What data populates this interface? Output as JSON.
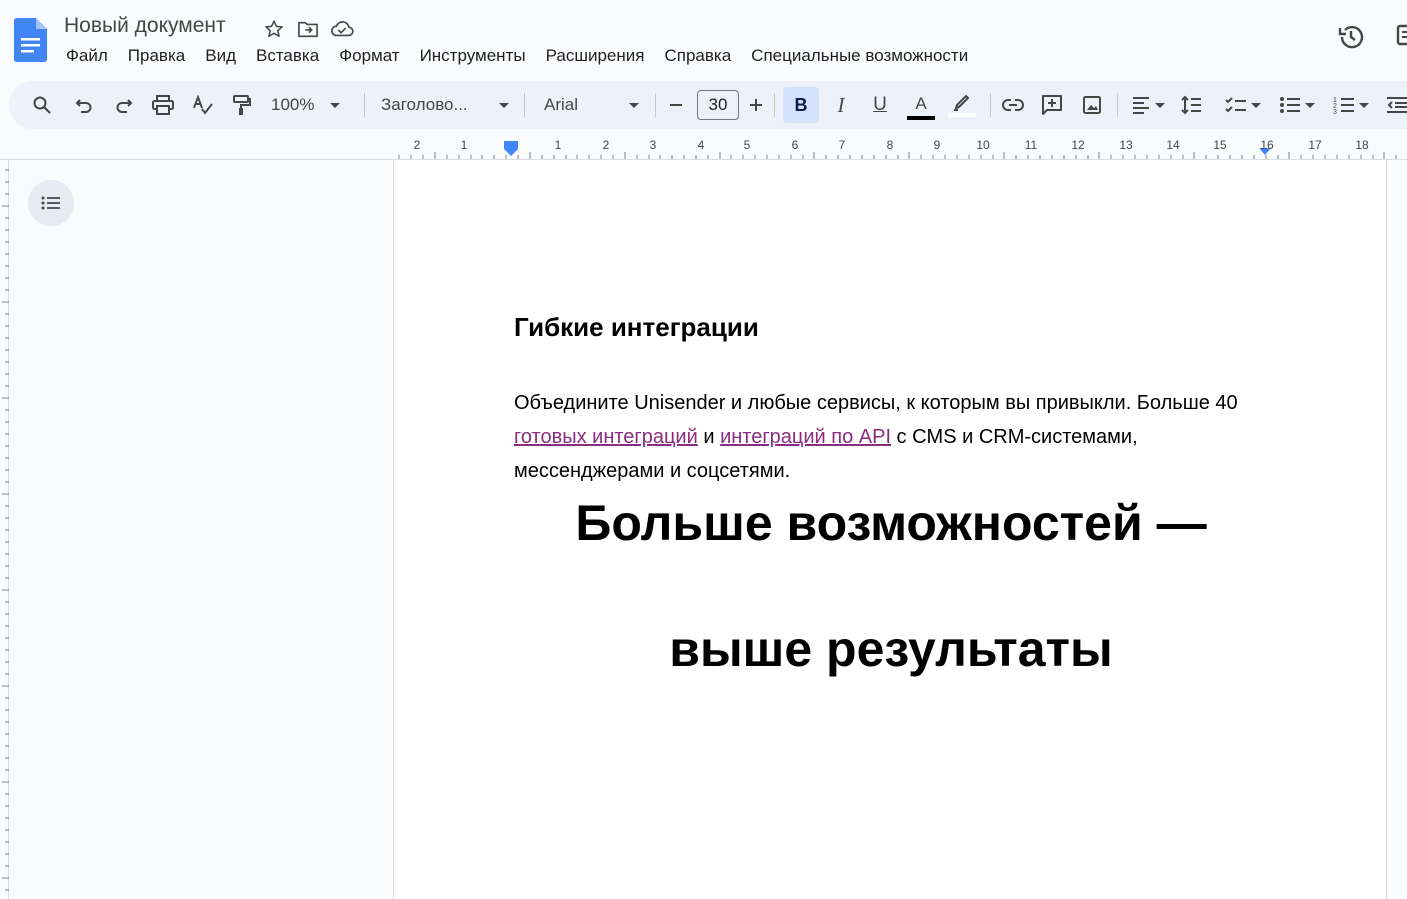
{
  "header": {
    "doc_title": "Новый документ",
    "menu": [
      "Файл",
      "Правка",
      "Вид",
      "Вставка",
      "Формат",
      "Инструменты",
      "Расширения",
      "Справка",
      "Специальные возможности"
    ]
  },
  "toolbar": {
    "zoom": "100%",
    "style": "Заголово...",
    "font": "Arial",
    "font_size": "30",
    "bold_label": "B",
    "italic_label": "I",
    "underline_label": "U",
    "text_color_label": "A",
    "colors": {
      "accent": "#0b57d0",
      "bold_active_bg": "#d3e3fd",
      "link": "#8a2d81"
    }
  },
  "ruler": {
    "labels": [
      "2",
      "1",
      "1",
      "2",
      "3",
      "4",
      "5",
      "6",
      "7",
      "8",
      "9",
      "10",
      "11",
      "12",
      "13",
      "14",
      "15",
      "16",
      "17",
      "18"
    ]
  },
  "document": {
    "heading": "Гибкие интеграции",
    "para_start": "Объедините Unisender и любые сервисы, к которым вы привыкли. Больше 40 ",
    "link1": "готовых интеграций",
    "para_mid": " и ",
    "link2": "интеграций по API",
    "para_end": " с CMS и CRM-системами, мессенджерами и соцсетями.",
    "big_line1": "Больше возможностей —",
    "big_line2": "выше результаты"
  }
}
